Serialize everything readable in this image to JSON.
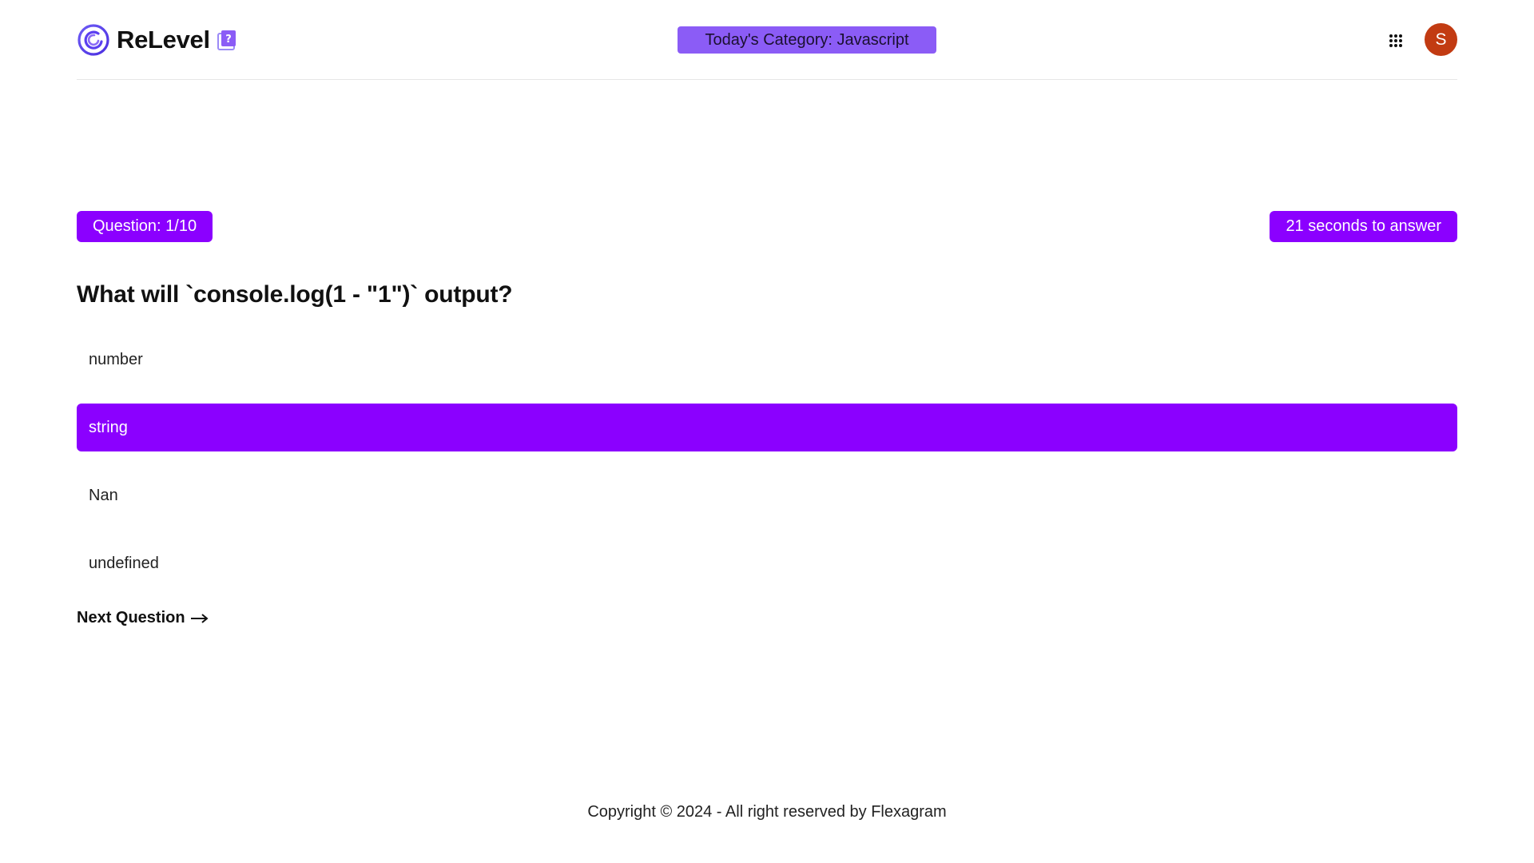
{
  "header": {
    "brand": "ReLevel",
    "logo_icon": "relevel-swirl-icon",
    "badge_icon": "question-book-icon",
    "category_label": "Today's Category: Javascript",
    "apps_icon": "grid-apps-icon",
    "avatar_initial": "S",
    "avatar_color": "#c23b12"
  },
  "quiz": {
    "question_counter": "Question: 1/10",
    "timer": "21 seconds to answer",
    "question": "What will `console.log(1 - \"1\")` output?",
    "options": [
      {
        "label": "number",
        "selected": false
      },
      {
        "label": "string",
        "selected": true
      },
      {
        "label": "Nan",
        "selected": false
      },
      {
        "label": "undefined",
        "selected": false
      }
    ],
    "next_label": "Next Question",
    "next_icon": "arrow-right-icon"
  },
  "footer": {
    "copyright": "Copyright © 2024 - All right reserved by Flexagram"
  },
  "colors": {
    "accent": "#8b00ff",
    "category_pill": "#8b5cf6"
  }
}
